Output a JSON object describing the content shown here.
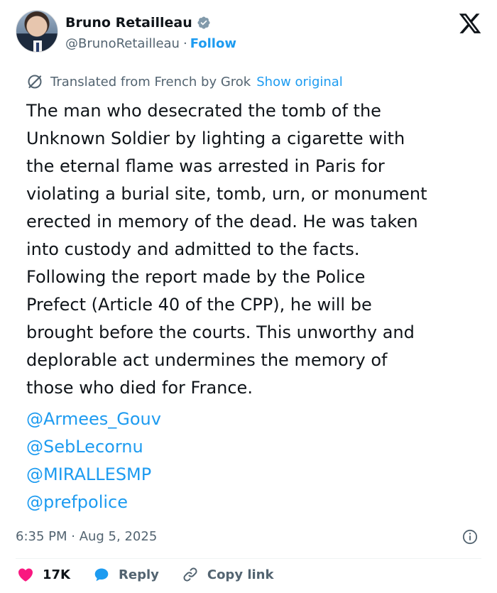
{
  "author": {
    "name": "Bruno Retailleau",
    "handle": "@BrunoRetailleau",
    "separator": "·",
    "follow_label": "Follow"
  },
  "translation": {
    "label": "Translated from French by Grok",
    "show_original_label": "Show original"
  },
  "tweet": {
    "lines": [
      "The man who desecrated the tomb of the",
      "Unknown Soldier by lighting a cigarette with",
      "the eternal flame was arrested in Paris for",
      "violating a burial site, tomb, urn, or monument",
      "erected in memory of the dead. He was taken",
      "into custody and admitted to the facts.",
      "Following the report made by the Police",
      "Prefect (Article 40 of the CPP), he will be",
      "brought before the courts. This unworthy and",
      "deplorable act undermines the memory of",
      "those who died for France."
    ],
    "mentions": [
      "@Armees_Gouv",
      "@SebLecornu",
      "@MIRALLESMP",
      "@prefpolice"
    ]
  },
  "meta": {
    "timestamp": "6:35 PM · Aug 5, 2025"
  },
  "actions": {
    "likes": "17K",
    "reply_label": "Reply",
    "copy_link_label": "Copy link"
  },
  "colors": {
    "link": "#1d9bf0",
    "like_heart": "#f91880",
    "reply_bubble": "#1d9bf0",
    "secondary_text": "#536471"
  },
  "icons": [
    "verified-badge-icon",
    "x-logo-icon",
    "grok-translate-icon",
    "info-icon",
    "heart-icon",
    "reply-bubble-icon",
    "link-icon"
  ]
}
